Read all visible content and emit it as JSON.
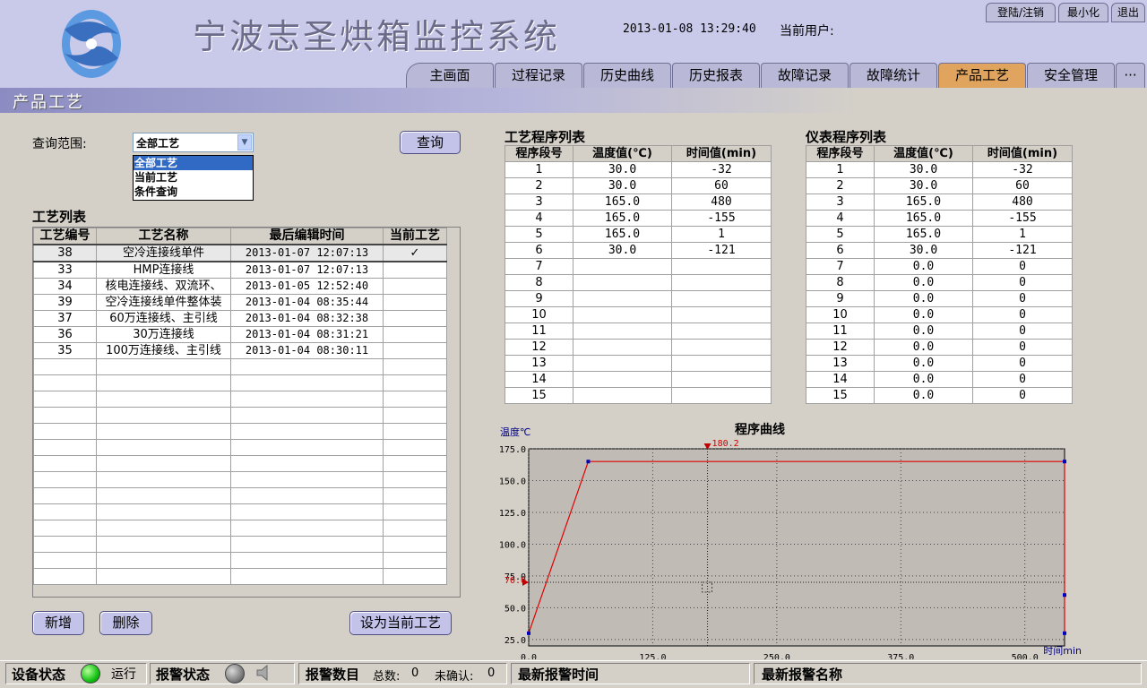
{
  "header": {
    "app_title": "宁波志圣烘箱监控系统",
    "datetime": "2013-01-08 13:29:40",
    "user_label": "当前用户:",
    "window_buttons": [
      "登陆/注销",
      "最小化",
      "退出"
    ]
  },
  "nav": {
    "tabs": [
      "主画面",
      "过程记录",
      "历史曲线",
      "历史报表",
      "故障记录",
      "故障统计",
      "产品工艺",
      "安全管理",
      "···"
    ],
    "active": "产品工艺"
  },
  "section_title": "产品工艺",
  "query": {
    "label": "查询范围:",
    "selected": "全部工艺",
    "options": [
      "全部工艺",
      "当前工艺",
      "条件查询"
    ],
    "button": "查询"
  },
  "process_list": {
    "title": "工艺列表",
    "columns": [
      "工艺编号",
      "工艺名称",
      "最后编辑时间",
      "当前工艺"
    ],
    "rows": [
      [
        "38",
        "空冷连接线单件",
        "2013-01-07 12:07:13",
        "✓"
      ],
      [
        "33",
        "HMP连接线",
        "2013-01-07 12:07:13",
        ""
      ],
      [
        "34",
        "核电连接线、双流环、",
        "2013-01-05 12:52:40",
        ""
      ],
      [
        "39",
        "空冷连接线单件整体装",
        "2013-01-04 08:35:44",
        ""
      ],
      [
        "37",
        "60万连接线、主引线",
        "2013-01-04 08:32:38",
        ""
      ],
      [
        "36",
        "30万连接线",
        "2013-01-04 08:31:21",
        ""
      ],
      [
        "35",
        "100万连接线、主引线",
        "2013-01-04 08:30:11",
        ""
      ]
    ],
    "empty_rows": 14
  },
  "buttons": {
    "add": "新增",
    "delete": "删除",
    "set_current": "设为当前工艺"
  },
  "process_program": {
    "title": "工艺程序列表",
    "columns": [
      "程序段号",
      "温度值(℃)",
      "时间值(min)"
    ],
    "rows": [
      [
        "1",
        "30.0",
        "-32"
      ],
      [
        "2",
        "30.0",
        "60"
      ],
      [
        "3",
        "165.0",
        "480"
      ],
      [
        "4",
        "165.0",
        "-155"
      ],
      [
        "5",
        "165.0",
        "1"
      ],
      [
        "6",
        "30.0",
        "-121"
      ],
      [
        "7",
        "",
        ""
      ],
      [
        "8",
        "",
        ""
      ],
      [
        "9",
        "",
        ""
      ],
      [
        "10",
        "",
        ""
      ],
      [
        "11",
        "",
        ""
      ],
      [
        "12",
        "",
        ""
      ],
      [
        "13",
        "",
        ""
      ],
      [
        "14",
        "",
        ""
      ],
      [
        "15",
        "",
        ""
      ]
    ]
  },
  "meter_program": {
    "title": "仪表程序列表",
    "columns": [
      "程序段号",
      "温度值(℃)",
      "时间值(min)"
    ],
    "rows": [
      [
        "1",
        "30.0",
        "-32"
      ],
      [
        "2",
        "30.0",
        "60"
      ],
      [
        "3",
        "165.0",
        "480"
      ],
      [
        "4",
        "165.0",
        "-155"
      ],
      [
        "5",
        "165.0",
        "1"
      ],
      [
        "6",
        "30.0",
        "-121"
      ],
      [
        "7",
        "0.0",
        "0"
      ],
      [
        "8",
        "0.0",
        "0"
      ],
      [
        "9",
        "0.0",
        "0"
      ],
      [
        "10",
        "0.0",
        "0"
      ],
      [
        "11",
        "0.0",
        "0"
      ],
      [
        "12",
        "0.0",
        "0"
      ],
      [
        "13",
        "0.0",
        "0"
      ],
      [
        "14",
        "0.0",
        "0"
      ],
      [
        "15",
        "0.0",
        "0"
      ]
    ]
  },
  "chart_data": {
    "type": "line",
    "title": "程序曲线",
    "ylabel": "温度℃",
    "xlabel": "时间min",
    "xlim": [
      0,
      540
    ],
    "ylim": [
      20,
      175
    ],
    "xticks": [
      "0.0",
      "125.0",
      "250.0",
      "375.0",
      "500.0"
    ],
    "yticks": [
      "175.0",
      "150.0",
      "125.0",
      "100.0",
      "75.0",
      "50.0",
      "25.0"
    ],
    "series": [
      {
        "x": [
          0,
          60,
          540,
          540,
          540
        ],
        "y": [
          30,
          165,
          165,
          60,
          30
        ]
      }
    ],
    "cursor": {
      "x": 180.2,
      "label": "180.2",
      "y_marker": 70.0,
      "y_label": "70.0"
    },
    "colors": {
      "line": "#e00000",
      "points": "#0000c0",
      "background": "#c0bcb5"
    }
  },
  "status_bar": {
    "device_status_label": "设备状态",
    "device_status_value": "运行",
    "alarm_status_label": "报警状态",
    "alarm_count_label": "报警数目",
    "total_label": "总数:",
    "total_value": "0",
    "unconfirmed_label": "未确认:",
    "unconfirmed_value": "0",
    "latest_alarm_time_label": "最新报警时间",
    "latest_alarm_name_label": "最新报警名称"
  }
}
